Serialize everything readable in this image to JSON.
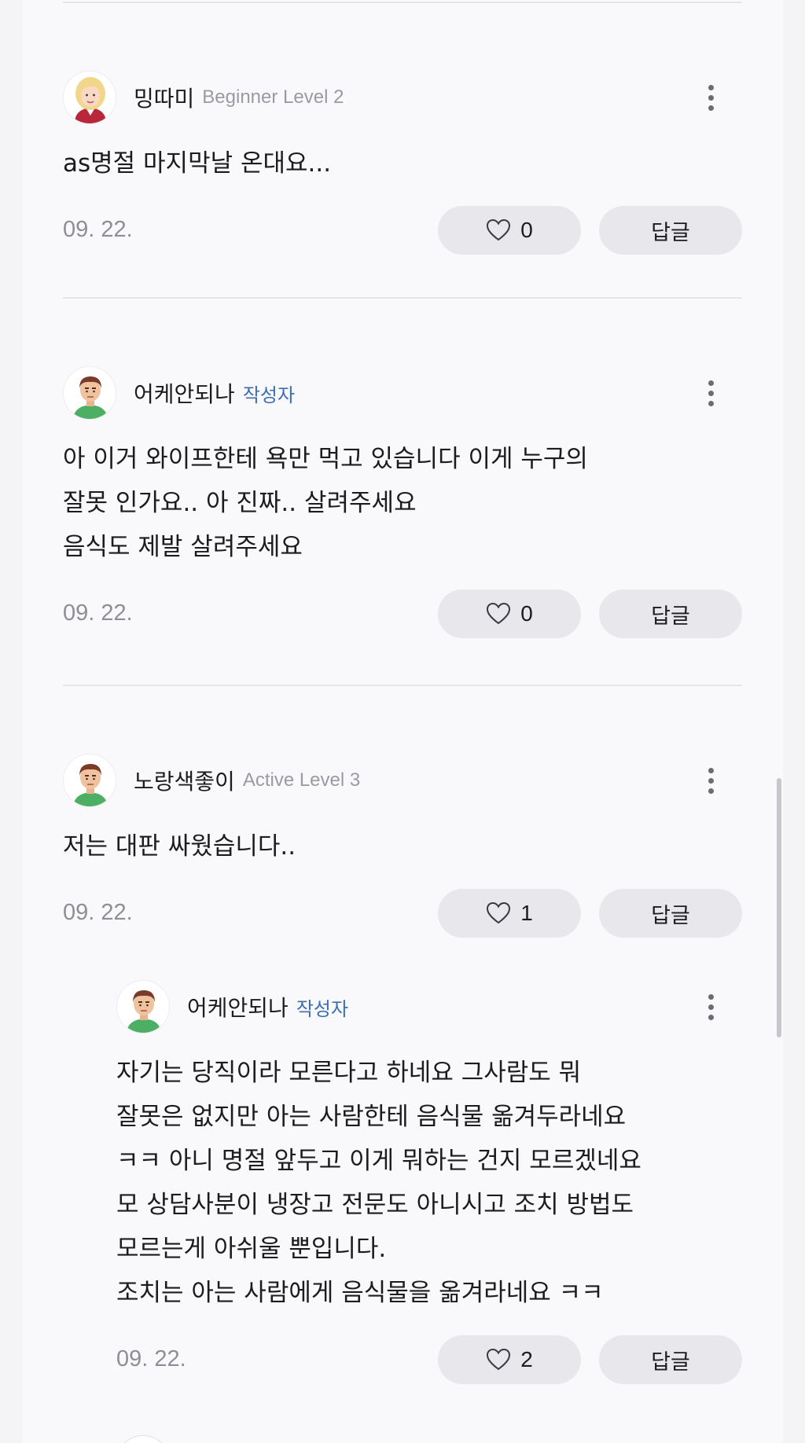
{
  "comments": [
    {
      "nickname": "밍따미",
      "badge": "Beginner Level 2",
      "badge_type": "level",
      "avatar_icon": "blonde-woman-avatar-icon",
      "text": "as명절 마지막날 온대요...",
      "date": "09. 22.",
      "likes": "0",
      "reply_label": "답글"
    },
    {
      "nickname": "어케안되나",
      "badge": "작성자",
      "badge_type": "author",
      "avatar_icon": "man-avatar-icon",
      "text": "아 이거 와이프한테 욕만 먹고 있습니다 이게 누구의\n잘못 인가요.. 아 진짜.. 살려주세요\n음식도 제발 살려주세요",
      "date": "09. 22.",
      "likes": "0",
      "reply_label": "답글"
    },
    {
      "nickname": "노랑색좋이",
      "badge": "Active Level 3",
      "badge_type": "level",
      "avatar_icon": "man-avatar-icon",
      "text": "저는 대판 싸웠습니다..",
      "date": "09. 22.",
      "likes": "1",
      "reply_label": "답글"
    },
    {
      "nickname": "어케안되나",
      "badge": "작성자",
      "badge_type": "author",
      "avatar_icon": "man-avatar-icon",
      "text": "자기는 당직이라 모른다고 하네요 그사람도 뭐\n잘못은 없지만 아는 사람한테 음식물 옮겨두라네요\nㅋㅋ 아니 명절 앞두고 이게 뭐하는 건지 모르겠네요\n모 상담사분이 냉장고 전문도 아니시고 조치 방법도\n모르는게 아쉬울 뿐입니다.\n조치는 아는 사람에게 음식물을 옮겨라네요 ㅋㅋ",
      "date": "09. 22.",
      "likes": "2",
      "reply_label": "답글"
    }
  ],
  "colors": {
    "author_badge": "#3a6fb5",
    "level_badge": "#9a9aa2",
    "button_bg": "#e8e8ec"
  }
}
